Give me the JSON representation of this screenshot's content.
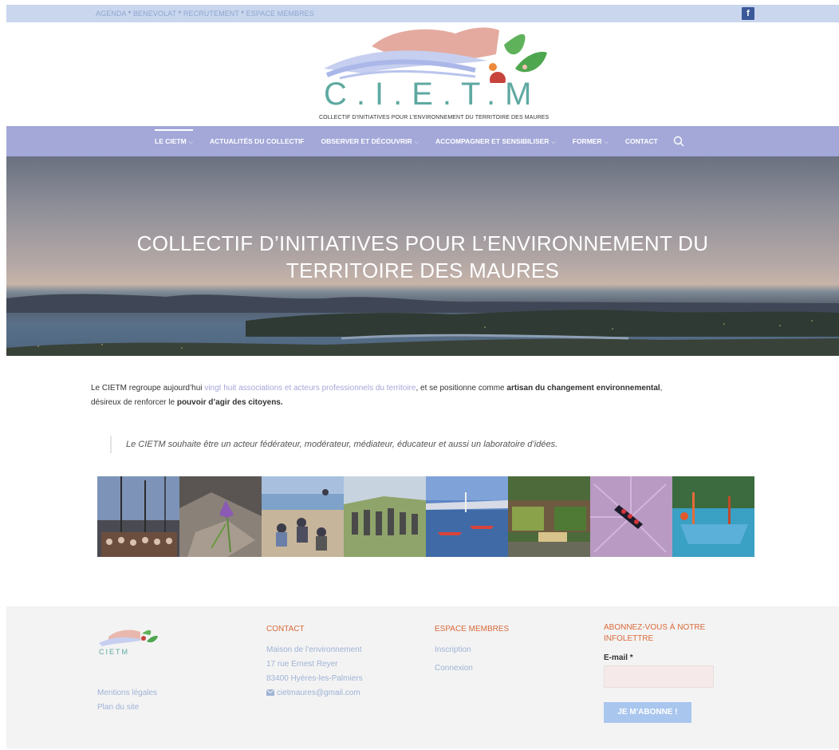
{
  "topbar": {
    "links": [
      "AGENDA",
      "BENEVOLAT",
      "RECRUTEMENT",
      "ESPACE MEMBRES"
    ],
    "separator": "*",
    "facebook_label": "f"
  },
  "logo": {
    "text": "C.I.E.T.M",
    "subtitle": "COLLECTIF D'INITIATIVES POUR L'ENVIRONNEMENT DU TERRITOIRE DES MAURES"
  },
  "nav": {
    "items": [
      {
        "label": "LE CIETM",
        "dropdown": true,
        "active": true
      },
      {
        "label": "ACTUALITÉS DU COLLECTIF",
        "dropdown": false
      },
      {
        "label": "OBSERVER ET DÉCOUVRIR",
        "dropdown": true
      },
      {
        "label": "ACCOMPAGNER ET SENSIBILISER",
        "dropdown": true
      },
      {
        "label": "FORMER",
        "dropdown": true
      },
      {
        "label": "CONTACT",
        "dropdown": false
      }
    ],
    "chevron": "⌵"
  },
  "hero": {
    "title_line1": "COLLECTIF D’INITIATIVES POUR L’ENVIRONNEMENT DU",
    "title_line2": "TERRITOIRE DES MAURES"
  },
  "intro": {
    "p1_a": "Le CIETM regroupe aujourd’hui ",
    "p1_link": "vingt huit associations et acteurs professionnels du territoire",
    "p1_b": ", et se positionne comme ",
    "p1_bold": "artisan du changement environnemental",
    "p1_c": ",",
    "p2_a": "désireux de renforcer le ",
    "p2_bold": "pouvoir d’agir des citoyens."
  },
  "quote": "Le CIETM souhaite être un acteur fédérateur, modérateur, médiateur, éducateur et aussi un laboratoire d’idées.",
  "footer": {
    "legal_links": [
      "Mentions légales",
      "Plan du site"
    ],
    "contact": {
      "heading": "CONTACT",
      "lines": [
        "Maison de l’environnement",
        "17 rue Ernest Reyer",
        "83400 Hyères-les-Palmiers"
      ],
      "email": "cietmaures@gmail.com"
    },
    "members": {
      "heading": "ESPACE MEMBRES",
      "links": [
        "Inscription",
        "Connexion"
      ]
    },
    "newsletter": {
      "heading_line1": "ABONNEZ-VOUS À NOTRE",
      "heading_line2": "INFOLETTRE",
      "email_label": "E-mail *",
      "button": "JE M'ABONNE !"
    }
  },
  "colors": {
    "topbar_bg": "#c9d6ee",
    "nav_bg": "#a3a8d8",
    "accent_orange": "#d96a3a",
    "link_blue": "#9fb3d6",
    "button_bg": "#a9c6ee"
  }
}
